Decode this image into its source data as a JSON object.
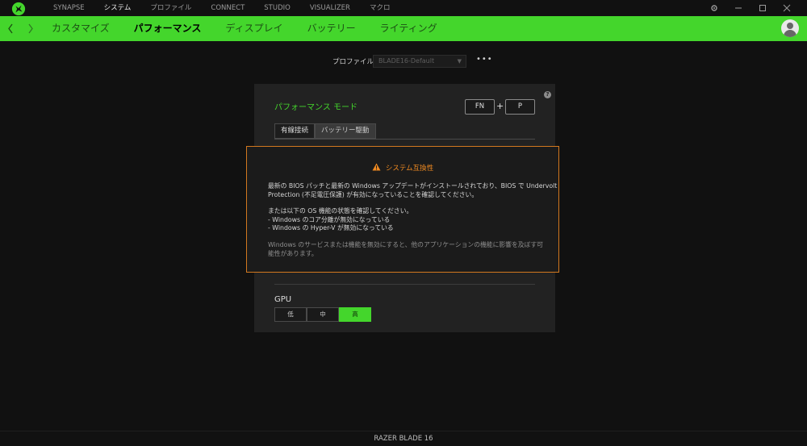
{
  "colors": {
    "accent": "#44d62c",
    "warning": "#f08a21",
    "background": "#111111",
    "panel": "#222222"
  },
  "titlebar": {
    "logo_icon": "razer-logo-icon",
    "nav": [
      {
        "label": "SYNAPSE",
        "active": false
      },
      {
        "label": "システム",
        "active": true
      },
      {
        "label": "プロファイル",
        "active": false
      },
      {
        "label": "CONNECT",
        "active": false
      },
      {
        "label": "STUDIO",
        "active": false
      },
      {
        "label": "VISUALIZER",
        "active": false
      },
      {
        "label": "マクロ",
        "active": false
      }
    ],
    "window_controls": [
      "gear-icon",
      "minimize-icon",
      "maximize-icon",
      "close-icon"
    ]
  },
  "subnav": {
    "back_icon": "chevron-left-icon",
    "forward_icon": "chevron-right-icon",
    "tabs": [
      {
        "label": "カスタマイズ",
        "active": false
      },
      {
        "label": "パフォーマンス",
        "active": true
      },
      {
        "label": "ディスプレイ",
        "active": false
      },
      {
        "label": "バッテリー",
        "active": false
      },
      {
        "label": "ライティング",
        "active": false
      }
    ],
    "avatar_icon": "user-avatar-icon"
  },
  "profile": {
    "label": "プロファイル",
    "selected": "BLADE16-Default",
    "more_icon": "more-dots-icon",
    "more_label": "•••"
  },
  "panel": {
    "title": "パフォーマンス モード",
    "help_icon": "question-icon",
    "help_label": "?",
    "shortcut": {
      "key1": "FN",
      "plus": "+",
      "key2": "P"
    },
    "mode_tabs": [
      {
        "label": "有線接続",
        "active": true
      },
      {
        "label": "バッテリー駆動",
        "active": false
      }
    ],
    "gpu": {
      "label": "GPU",
      "options": [
        {
          "label": "低",
          "selected": false
        },
        {
          "label": "中",
          "selected": false
        },
        {
          "label": "高",
          "selected": true
        }
      ]
    }
  },
  "dialog": {
    "icon": "warning-triangle-icon",
    "title": "システム互換性",
    "line1": "最新の BIOS パッチと最新の Windows アップデートがインストールされており、BIOS で Undervolt",
    "line2": "Protection (不足電圧保護) が有効になっていることを確認してください。",
    "line3": "または以下の OS 機能の状態を確認してください。",
    "line4": "- Windows のコア分離が無効になっている",
    "line5": "- Windows の Hyper-V が無効になっている",
    "note": "Windows のサービスまたは機能を無効にすると、他のアプリケーションの機能に影響を及ぼす可能性があります。"
  },
  "status": {
    "device_name": "RAZER BLADE 16"
  }
}
